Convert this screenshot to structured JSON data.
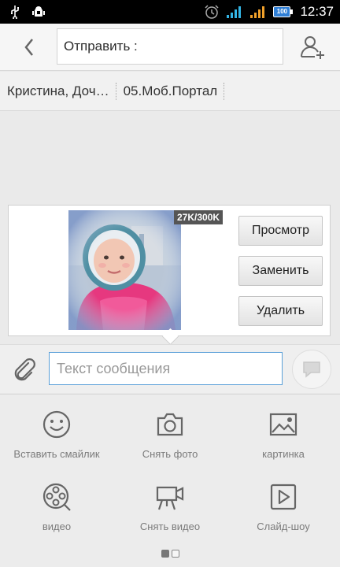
{
  "status_bar": {
    "time": "12:37",
    "battery": "100"
  },
  "header": {
    "to_label": "Отправить :"
  },
  "recipients": [
    "Кристина, Доч…",
    "05.Моб.Портал"
  ],
  "attachment": {
    "size_badge": "27K/300K",
    "buttons": {
      "view": "Просмотр",
      "replace": "Заменить",
      "delete": "Удалить"
    }
  },
  "compose": {
    "placeholder": "Текст сообщения"
  },
  "tools": [
    {
      "label": "Вставить смайлик",
      "icon": "smiley-icon"
    },
    {
      "label": "Снять фото",
      "icon": "camera-icon"
    },
    {
      "label": "картинка",
      "icon": "image-icon"
    },
    {
      "label": "видео",
      "icon": "film-reel-icon"
    },
    {
      "label": "Снять видео",
      "icon": "video-camera-icon"
    },
    {
      "label": "Слайд-шоу",
      "icon": "slideshow-icon"
    }
  ],
  "pager": {
    "current": 1,
    "total": 2
  },
  "colors": {
    "accent": "#5aa0d8",
    "status_bar": "#000000"
  }
}
